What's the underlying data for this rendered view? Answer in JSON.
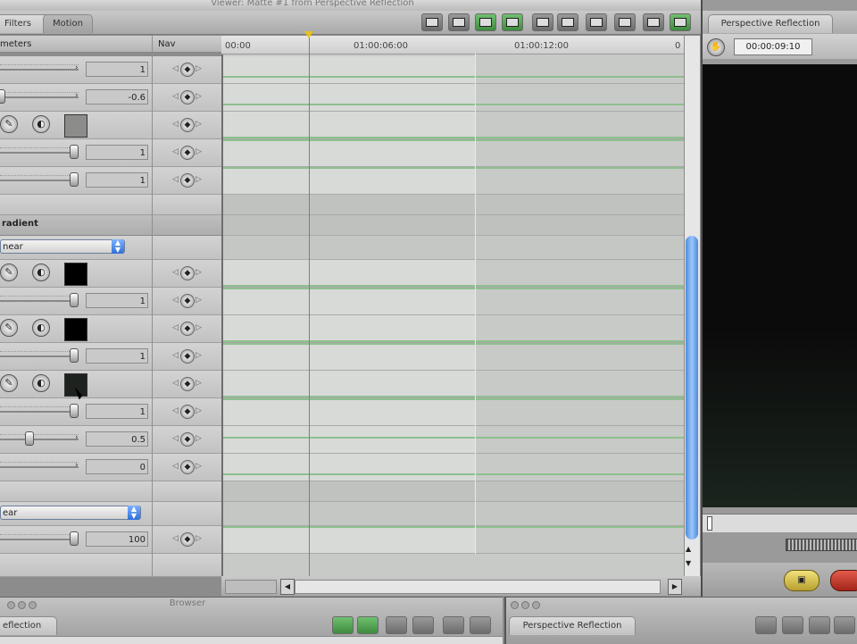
{
  "window": {
    "title": "Viewer: Matte #1 from Perspective Reflection"
  },
  "tabs": {
    "filters": "Filters",
    "motion": "Motion"
  },
  "columns": {
    "parameters": "meters",
    "nav": "Nav"
  },
  "ruler": {
    "start": "00:00",
    "mid": "01:00:06:00",
    "late": "01:00:12:00",
    "end": "0"
  },
  "params": {
    "r1": "1",
    "r2": "-0.6",
    "r4": "1",
    "r5": "1",
    "section_gradient": "radient",
    "gradient_select": "near",
    "r9": "1",
    "r11": "1",
    "r13": "1",
    "r14": "0.5",
    "r15": "0",
    "section_blank": "",
    "blend_select": "ear",
    "r18": "100"
  },
  "canvas": {
    "tab": "Perspective Reflection",
    "timecode": "00:00:09:10"
  },
  "browser": {
    "title": "Browser",
    "tab": "eflection"
  },
  "timeline2": {
    "tab": "Perspective Reflection"
  },
  "colors": {
    "accent_blue": "#4d8ad8",
    "track_green": "#8fbf8f",
    "playhead_yellow": "#e6c21c"
  }
}
